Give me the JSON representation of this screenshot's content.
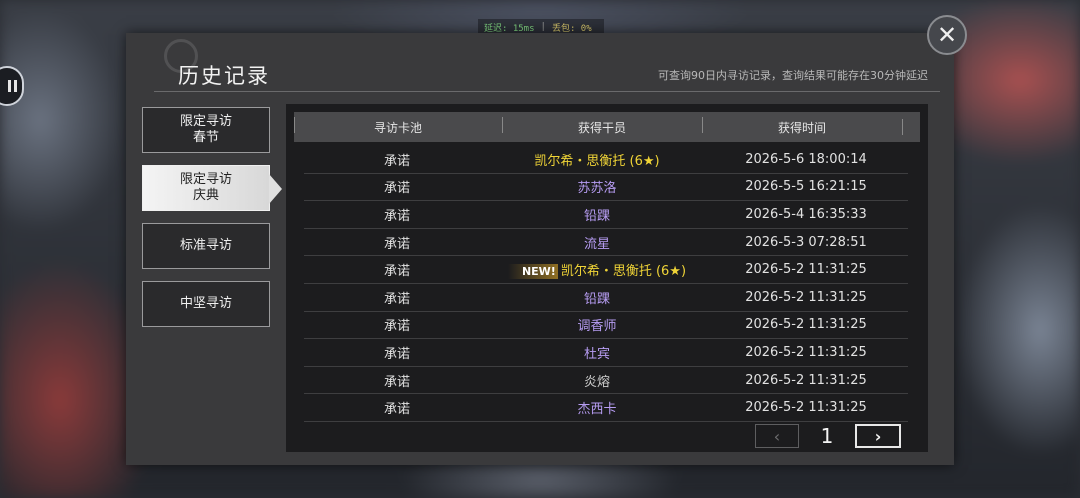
{
  "status": {
    "latency": "延迟: 15ms",
    "loss": "丢包: 0%"
  },
  "panel": {
    "title": "历史记录",
    "notice": "可查询90日内寻访记录，查询结果可能存在30分钟延迟"
  },
  "close_icon": "close-icon",
  "tabs": [
    {
      "label": "限定寻访\n春节",
      "active": false
    },
    {
      "label": "限定寻访\n庆典",
      "active": true
    },
    {
      "label": "标准寻访",
      "active": false
    },
    {
      "label": "中坚寻访",
      "active": false
    }
  ],
  "table": {
    "headers": [
      "寻访卡池",
      "获得干员",
      "获得时间"
    ],
    "rows": [
      {
        "pool": "承诺",
        "operator": "凯尔希・思衡托 (6★)",
        "time": "2026-5-6 18:00:14",
        "rarity": "gold",
        "new": ""
      },
      {
        "pool": "承诺",
        "operator": "苏苏洛",
        "time": "2026-5-5 16:21:15",
        "rarity": "purple",
        "new": ""
      },
      {
        "pool": "承诺",
        "operator": "铅踝",
        "time": "2026-5-4 16:35:33",
        "rarity": "purple",
        "new": ""
      },
      {
        "pool": "承诺",
        "operator": "流星",
        "time": "2026-5-3 07:28:51",
        "rarity": "purple",
        "new": ""
      },
      {
        "pool": "承诺",
        "operator": "凯尔希・思衡托 (6★)",
        "time": "2026-5-2 11:31:25",
        "rarity": "gold",
        "new": "NEW!"
      },
      {
        "pool": "承诺",
        "operator": "铅踝",
        "time": "2026-5-2 11:31:25",
        "rarity": "purple",
        "new": ""
      },
      {
        "pool": "承诺",
        "operator": "调香师",
        "time": "2026-5-2 11:31:25",
        "rarity": "purple",
        "new": ""
      },
      {
        "pool": "承诺",
        "operator": "杜宾",
        "time": "2026-5-2 11:31:25",
        "rarity": "purple",
        "new": ""
      },
      {
        "pool": "承诺",
        "operator": "炎熔",
        "time": "2026-5-2 11:31:25",
        "rarity": "gray",
        "new": ""
      },
      {
        "pool": "承诺",
        "operator": "杰西卡",
        "time": "2026-5-2 11:31:25",
        "rarity": "purple",
        "new": ""
      }
    ]
  },
  "pager": {
    "prev": "‹",
    "page": "1",
    "next": "›"
  },
  "colors": {
    "gold": "#f0d437",
    "purple": "#b69cf2",
    "gray": "#cfcfcf"
  }
}
